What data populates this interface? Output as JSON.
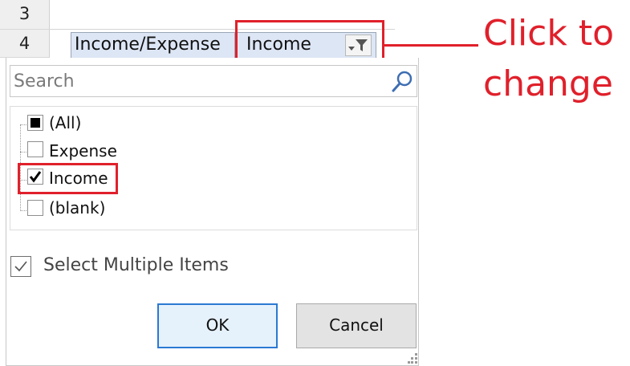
{
  "rows": {
    "row3": "3",
    "row4": "4"
  },
  "pivot": {
    "field_label": "Income/Expense",
    "field_value": "Income"
  },
  "annotation": {
    "line1": "Click to",
    "line2": "change"
  },
  "filter": {
    "search_placeholder": "Search",
    "items": [
      {
        "label": "(All)",
        "state": "partial"
      },
      {
        "label": "Expense",
        "state": "unchecked"
      },
      {
        "label": "Income",
        "state": "checked"
      },
      {
        "label": "(blank)",
        "state": "unchecked"
      }
    ],
    "select_multiple_label": "Select Multiple Items",
    "ok_label": "OK",
    "cancel_label": "Cancel"
  },
  "colors": {
    "annotation": "#e0202b",
    "pivot_cell_bg": "#dde6f5",
    "ok_border": "#2b79d3"
  }
}
